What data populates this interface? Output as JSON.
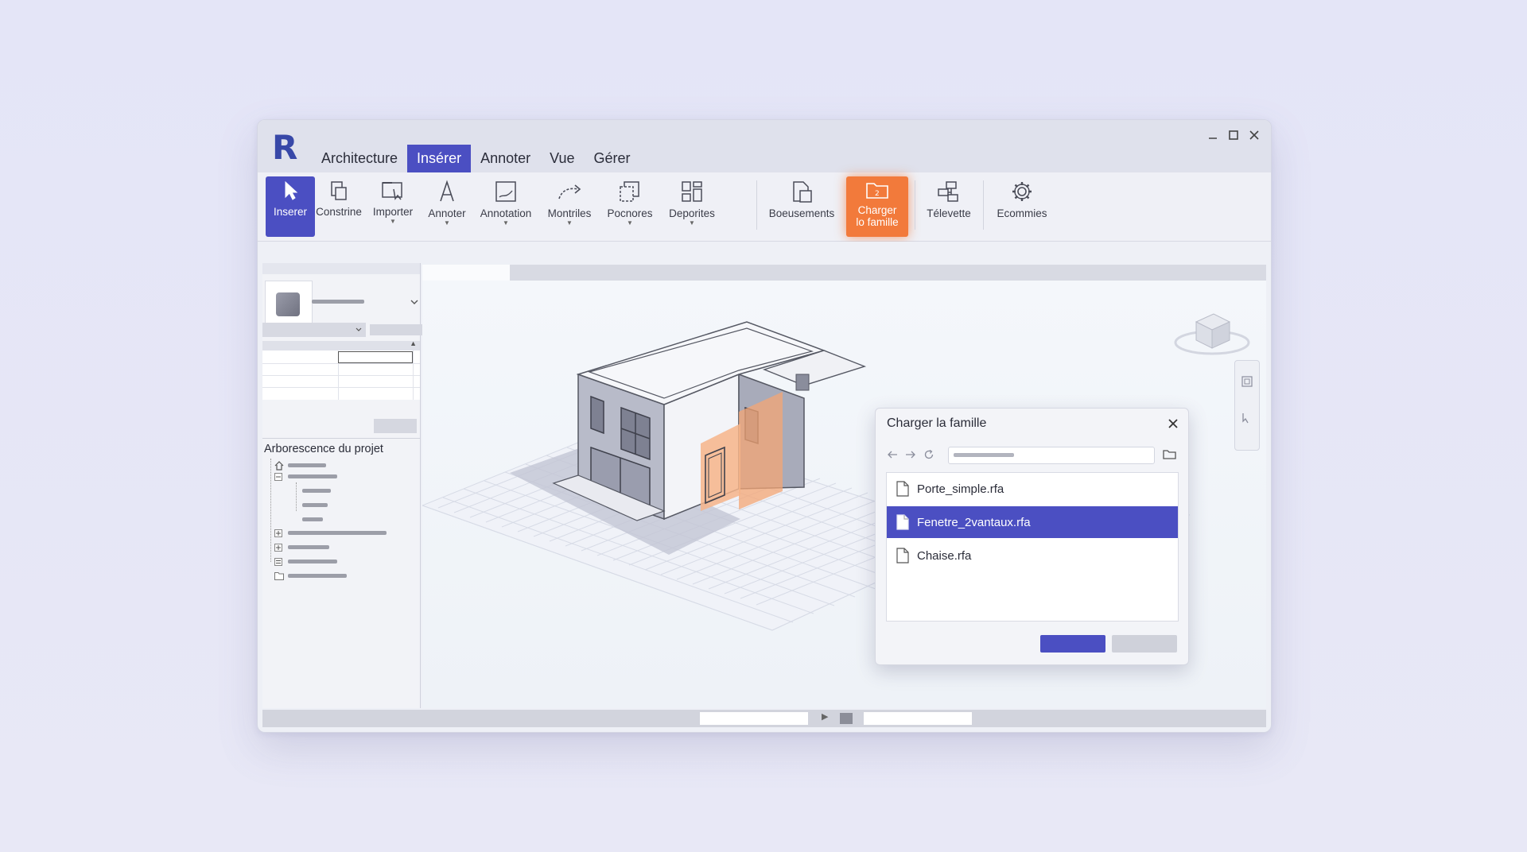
{
  "menu": {
    "tabs": [
      "Architecture",
      "Insérer",
      "Annoter",
      "Vue",
      "Gérer"
    ],
    "active": "Insérer"
  },
  "ribbon": {
    "buttons": [
      {
        "label": "Inserer",
        "icon": "cursor-icon"
      },
      {
        "label": "Constrine",
        "icon": "construct-icon"
      },
      {
        "label": "Importer",
        "icon": "import-icon"
      },
      {
        "label": "Annoter",
        "icon": "text-a-icon"
      },
      {
        "label": "Annotation",
        "icon": "annotation-icon"
      },
      {
        "label": "Montriles",
        "icon": "arrow-curve-icon"
      },
      {
        "label": "Pocnores",
        "icon": "panels-icon"
      },
      {
        "label": "Deporites",
        "icon": "grid-icon"
      },
      {
        "label": "Boeusements",
        "icon": "documents-icon"
      },
      {
        "label": "Charger lo famille",
        "icon": "load-family-folder-icon"
      },
      {
        "label": "Télevette",
        "icon": "network-icon"
      },
      {
        "label": "Ecommies",
        "icon": "gear-icon"
      }
    ]
  },
  "project_browser": {
    "title": "Arborescence du projet"
  },
  "dialog": {
    "title": "Charger la famille",
    "files": [
      {
        "name": "Porte_simple.rfa",
        "selected": false
      },
      {
        "name": "Fenetre_2vantaux.rfa",
        "selected": true
      },
      {
        "name": "Chaise.rfa",
        "selected": false
      }
    ]
  },
  "colors": {
    "accent": "#4b4fc2",
    "highlight": "#f27a3b",
    "logo": "#3848a8"
  }
}
